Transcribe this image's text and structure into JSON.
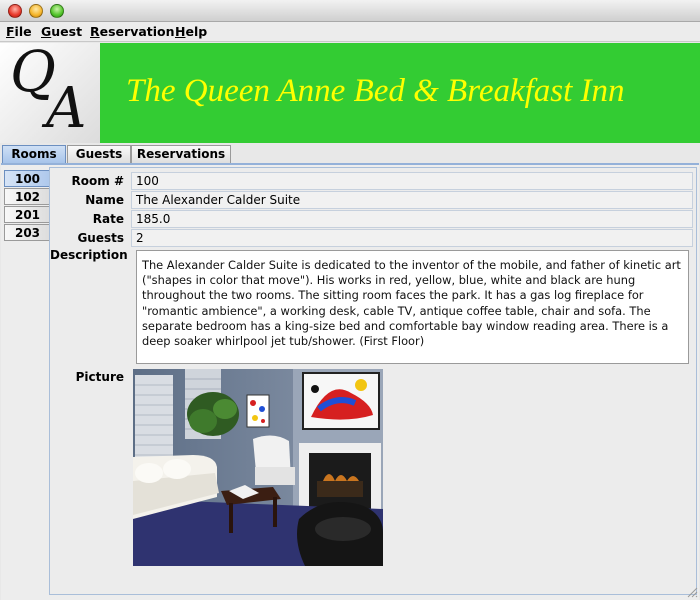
{
  "window": {
    "controls": [
      "close",
      "minimize",
      "zoom"
    ]
  },
  "menu": {
    "items": [
      {
        "mnemonic": "F",
        "rest": "ile"
      },
      {
        "mnemonic": "G",
        "rest": "uest"
      },
      {
        "mnemonic": "R",
        "rest": "eservation"
      },
      {
        "mnemonic": "H",
        "rest": "elp"
      }
    ]
  },
  "banner": {
    "logo_q": "Q",
    "logo_a": "A",
    "title": "The Queen Anne Bed & Breakfast Inn",
    "background_color": "#33cc33",
    "title_color": "#ffff00"
  },
  "tabs": [
    {
      "label": "Rooms",
      "active": true
    },
    {
      "label": "Guests",
      "active": false
    },
    {
      "label": "Reservations",
      "active": false
    }
  ],
  "room_tabs": [
    {
      "label": "100",
      "active": true
    },
    {
      "label": "102",
      "active": false
    },
    {
      "label": "201",
      "active": false
    },
    {
      "label": "203",
      "active": false
    }
  ],
  "room": {
    "labels": {
      "room_no": "Room #",
      "name": "Name",
      "rate": "Rate",
      "guests": "Guests",
      "description": "Description",
      "picture": "Picture"
    },
    "room_no": "100",
    "name": "The Alexander Calder Suite",
    "rate": "185.0",
    "guests": "2",
    "description": "The Alexander Calder Suite is dedicated to the inventor of the mobile, and father of kinetic art (\"shapes in color that move\"). His works in red, yellow, blue, white and black are hung throughout the two rooms. The sitting room faces the park. It has a gas log fireplace for \"romantic ambience\", a working desk, cable TV, antique coffee table, chair and sofa. The separate bedroom has a king-size bed and comfortable bay window reading area. There is a deep soaker whirlpool jet tub/shower. (First Floor)"
  }
}
